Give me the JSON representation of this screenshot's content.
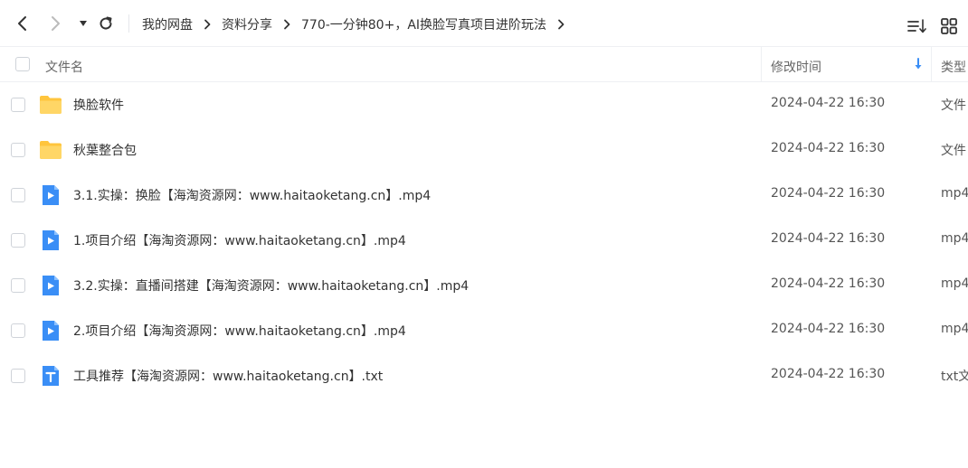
{
  "breadcrumb": [
    "我的网盘",
    "资料分享",
    "770-一分钟80+，AI换脸写真项目进阶玩法"
  ],
  "columns": {
    "name": "文件名",
    "modified": "修改时间",
    "type": "类型"
  },
  "colors": {
    "folder": "#FFC53D",
    "video": "#3A8EF6",
    "text": "#3A8EF6",
    "sort": "#3A8EF6"
  },
  "files": [
    {
      "name": "换脸软件",
      "date": "2024-04-22 16:30",
      "type": "文件",
      "icon": "folder-icon"
    },
    {
      "name": "秋葉整合包",
      "date": "2024-04-22 16:30",
      "type": "文件",
      "icon": "folder-icon"
    },
    {
      "name": "3.1.实操：换脸【海淘资源网：www.haitaoketang.cn】.mp4",
      "date": "2024-04-22 16:30",
      "type": "mp4",
      "icon": "video-file-icon"
    },
    {
      "name": "1.项目介绍【海淘资源网：www.haitaoketang.cn】.mp4",
      "date": "2024-04-22 16:30",
      "type": "mp4",
      "icon": "video-file-icon"
    },
    {
      "name": "3.2.实操：直播间搭建【海淘资源网：www.haitaoketang.cn】.mp4",
      "date": "2024-04-22 16:30",
      "type": "mp4",
      "icon": "video-file-icon"
    },
    {
      "name": "2.项目介绍【海淘资源网：www.haitaoketang.cn】.mp4",
      "date": "2024-04-22 16:30",
      "type": "mp4",
      "icon": "video-file-icon"
    },
    {
      "name": "工具推荐【海淘资源网：www.haitaoketang.cn】.txt",
      "date": "2024-04-22 16:30",
      "type": "txt文",
      "icon": "text-file-icon"
    }
  ]
}
